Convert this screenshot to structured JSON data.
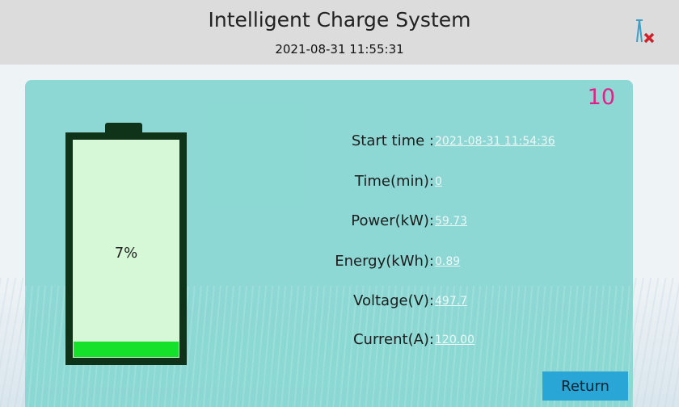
{
  "header": {
    "title": "Intelligent Charge System",
    "datetime": "2021-08-31 11:55:31",
    "network_status_icon": "network-disconnected-icon"
  },
  "panel": {
    "countdown": "10",
    "battery": {
      "percent_label": "7%",
      "level_fraction": 0.07
    },
    "info": [
      {
        "label": "Start time :",
        "value": "2021-08-31 11:54:36"
      },
      {
        "label": "Time(min):",
        "value": "0"
      },
      {
        "label": "Power(kW):",
        "value": "59.73"
      },
      {
        "label": "Energy(kWh):",
        "value": "0.89"
      },
      {
        "label": "Voltage(V):",
        "value": "497.7"
      },
      {
        "label": "Current(A):",
        "value": "120.00"
      }
    ],
    "return_label": "Return"
  },
  "colors": {
    "header_bg": "#dcdcdc",
    "panel_bg": "#84d6d0",
    "countdown": "#e0218a",
    "battery_fill": "#16e12a",
    "return_button": "#2aa6d6"
  }
}
